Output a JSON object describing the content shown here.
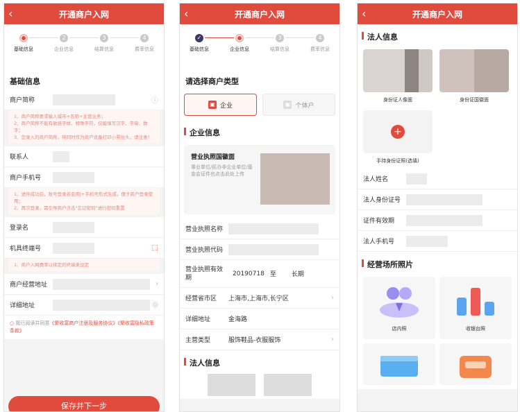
{
  "screens": [
    {
      "title": "开通商户入网",
      "steps": [
        "基础信息",
        "企业信息",
        "结算信息",
        "费率信息"
      ],
      "section_title": "基础信息",
      "merchant_short_name_label": "商户简称",
      "note1": "1、商户简称要求输入城市+名称+主营业务；\n2、商户简称不能有敏感字样、特殊字符，仅能填写汉字、字母、数字；\n3、您录入的商户简称，将同时作为商户设备打印小票抬头，请注意！",
      "contact_label": "联系人",
      "phone_label": "商户手机号",
      "note2": "1、进件成功后，账号登录名会用J+手机号形式生成，便于商户登录使用；\n2、再次登录，需引导商户点击\"忘记密码\"进行密码重置",
      "login_label": "登录名",
      "terminal_label": "机具终端号",
      "note3": "1、商户入网费率以绑定的终端来设定",
      "address_label": "商户经营地址",
      "detail_address_label": "详细地址",
      "agree_text": "我已阅读并同意",
      "agree_link": "《聚收富商户注册及服务协议》《聚收富隐私政策条款》",
      "submit_label": "保存并下一步"
    },
    {
      "title": "开通商户入网",
      "steps": [
        "基础信息",
        "企业信息",
        "结算信息",
        "费率信息"
      ],
      "choose_type_title": "请选择商户类型",
      "type_enterprise": "企业",
      "type_individual": "个体户",
      "enterprise_section": "企业信息",
      "license_title": "营业执照国徽面",
      "license_desc": "事业单位/民办非企业单位/基金会证件也点击此处上传",
      "license_name_label": "营业执照名称",
      "license_code_label": "营业执照代码",
      "validity_label": "营业执照有效期",
      "validity_start": "20190718",
      "validity_to": "至",
      "validity_end": "长期",
      "region_label": "经营省市区",
      "region_value": "上海市,上海市,长宁区",
      "detail_address_label": "详细地址",
      "detail_address_value": "金海路",
      "category_label": "主营类型",
      "category_value": "服饰鞋品-衣服服饰",
      "legal_section": "法人信息"
    },
    {
      "title": "开通商户入网",
      "legal_section": "法人信息",
      "id_front_caption": "身份证人像面",
      "id_back_caption": "身份证国徽面",
      "handheld_caption": "手持身份证照(选填)",
      "legal_name_label": "法人姓名",
      "legal_id_label": "法人身份证号",
      "validity_label": "证件有效期",
      "legal_phone_label": "法人手机号",
      "photos_section": "经营场所照片",
      "photo_store": "店内照",
      "photo_cashier": "收银台照"
    }
  ],
  "colors": {
    "brand": "#e04b3d",
    "note_bg": "#fff6f4",
    "note_text": "#e08a80"
  },
  "icons": [
    "back-arrow-icon",
    "question-icon",
    "scan-icon",
    "chevron-right-icon",
    "location-icon",
    "radio-icon",
    "enterprise-icon",
    "individual-icon",
    "plus-icon"
  ]
}
